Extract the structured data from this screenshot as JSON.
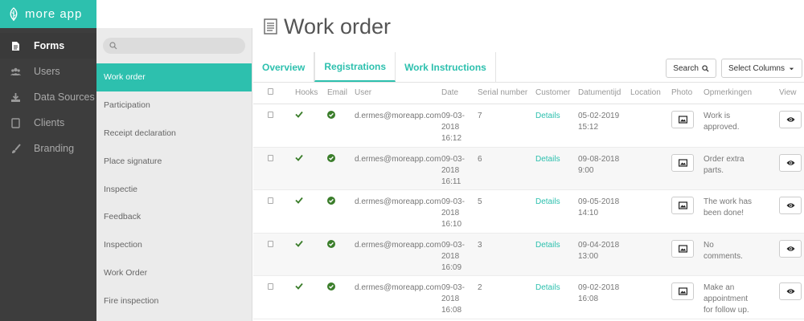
{
  "brand": {
    "name": "more app"
  },
  "nav": {
    "items": [
      {
        "label": "Forms",
        "icon": "document-icon",
        "active": true
      },
      {
        "label": "Users",
        "icon": "users-icon",
        "active": false
      },
      {
        "label": "Data Sources",
        "icon": "download-icon",
        "active": false
      },
      {
        "label": "Clients",
        "icon": "tablet-icon",
        "active": false
      },
      {
        "label": "Branding",
        "icon": "brush-icon",
        "active": false
      }
    ]
  },
  "forms": {
    "search_placeholder": "",
    "items": [
      {
        "label": "Work order",
        "active": true
      },
      {
        "label": "Participation"
      },
      {
        "label": "Receipt declaration"
      },
      {
        "label": "Place signature"
      },
      {
        "label": "Inspectie"
      },
      {
        "label": "Feedback"
      },
      {
        "label": "Inspection"
      },
      {
        "label": "Work Order"
      },
      {
        "label": "Fire inspection"
      }
    ]
  },
  "main": {
    "title": "Work order",
    "tabs": [
      {
        "label": "Overview"
      },
      {
        "label": "Registrations",
        "active": true
      },
      {
        "label": "Work Instructions"
      }
    ],
    "search_button": "Search",
    "select_columns_button": "Select Columns",
    "columns": {
      "hooks": "Hooks",
      "email": "Email",
      "user": "User",
      "date": "Date",
      "serial": "Serial number",
      "customer": "Customer",
      "datumentijd": "Datumentijd",
      "location": "Location",
      "photo": "Photo",
      "opmerkingen": "Opmerkingen",
      "view": "View"
    },
    "rows": [
      {
        "user": "d.ermes@moreapp.com",
        "date": [
          "09-03-",
          "2018",
          "16:12"
        ],
        "serial": "7",
        "customer": "Details",
        "datumentijd": [
          "05-02-2019",
          "15:12"
        ],
        "opmerkingen": [
          "Work is",
          "approved."
        ]
      },
      {
        "user": "d.ermes@moreapp.com",
        "date": [
          "09-03-",
          "2018",
          "16:11"
        ],
        "serial": "6",
        "customer": "Details",
        "datumentijd": [
          "09-08-2018",
          "9:00"
        ],
        "opmerkingen": [
          "Order extra",
          "parts."
        ]
      },
      {
        "user": "d.ermes@moreapp.com",
        "date": [
          "09-03-",
          "2018",
          "16:10"
        ],
        "serial": "5",
        "customer": "Details",
        "datumentijd": [
          "09-05-2018",
          "14:10"
        ],
        "opmerkingen": [
          "The work has",
          "been done!"
        ]
      },
      {
        "user": "d.ermes@moreapp.com",
        "date": [
          "09-03-",
          "2018",
          "16:09"
        ],
        "serial": "3",
        "customer": "Details",
        "datumentijd": [
          "09-04-2018",
          "13:00"
        ],
        "opmerkingen": [
          "No",
          "comments."
        ]
      },
      {
        "user": "d.ermes@moreapp.com",
        "date": [
          "09-03-",
          "2018",
          "16:08"
        ],
        "serial": "2",
        "customer": "Details",
        "datumentijd": [
          "09-02-2018",
          "16:08"
        ],
        "opmerkingen": [
          "Make an",
          "appointment",
          "for follow up."
        ]
      }
    ]
  },
  "colors": {
    "accent": "#2dc0ae",
    "nav_bg": "#3d3d3d",
    "check_green": "#3a7d2a"
  }
}
